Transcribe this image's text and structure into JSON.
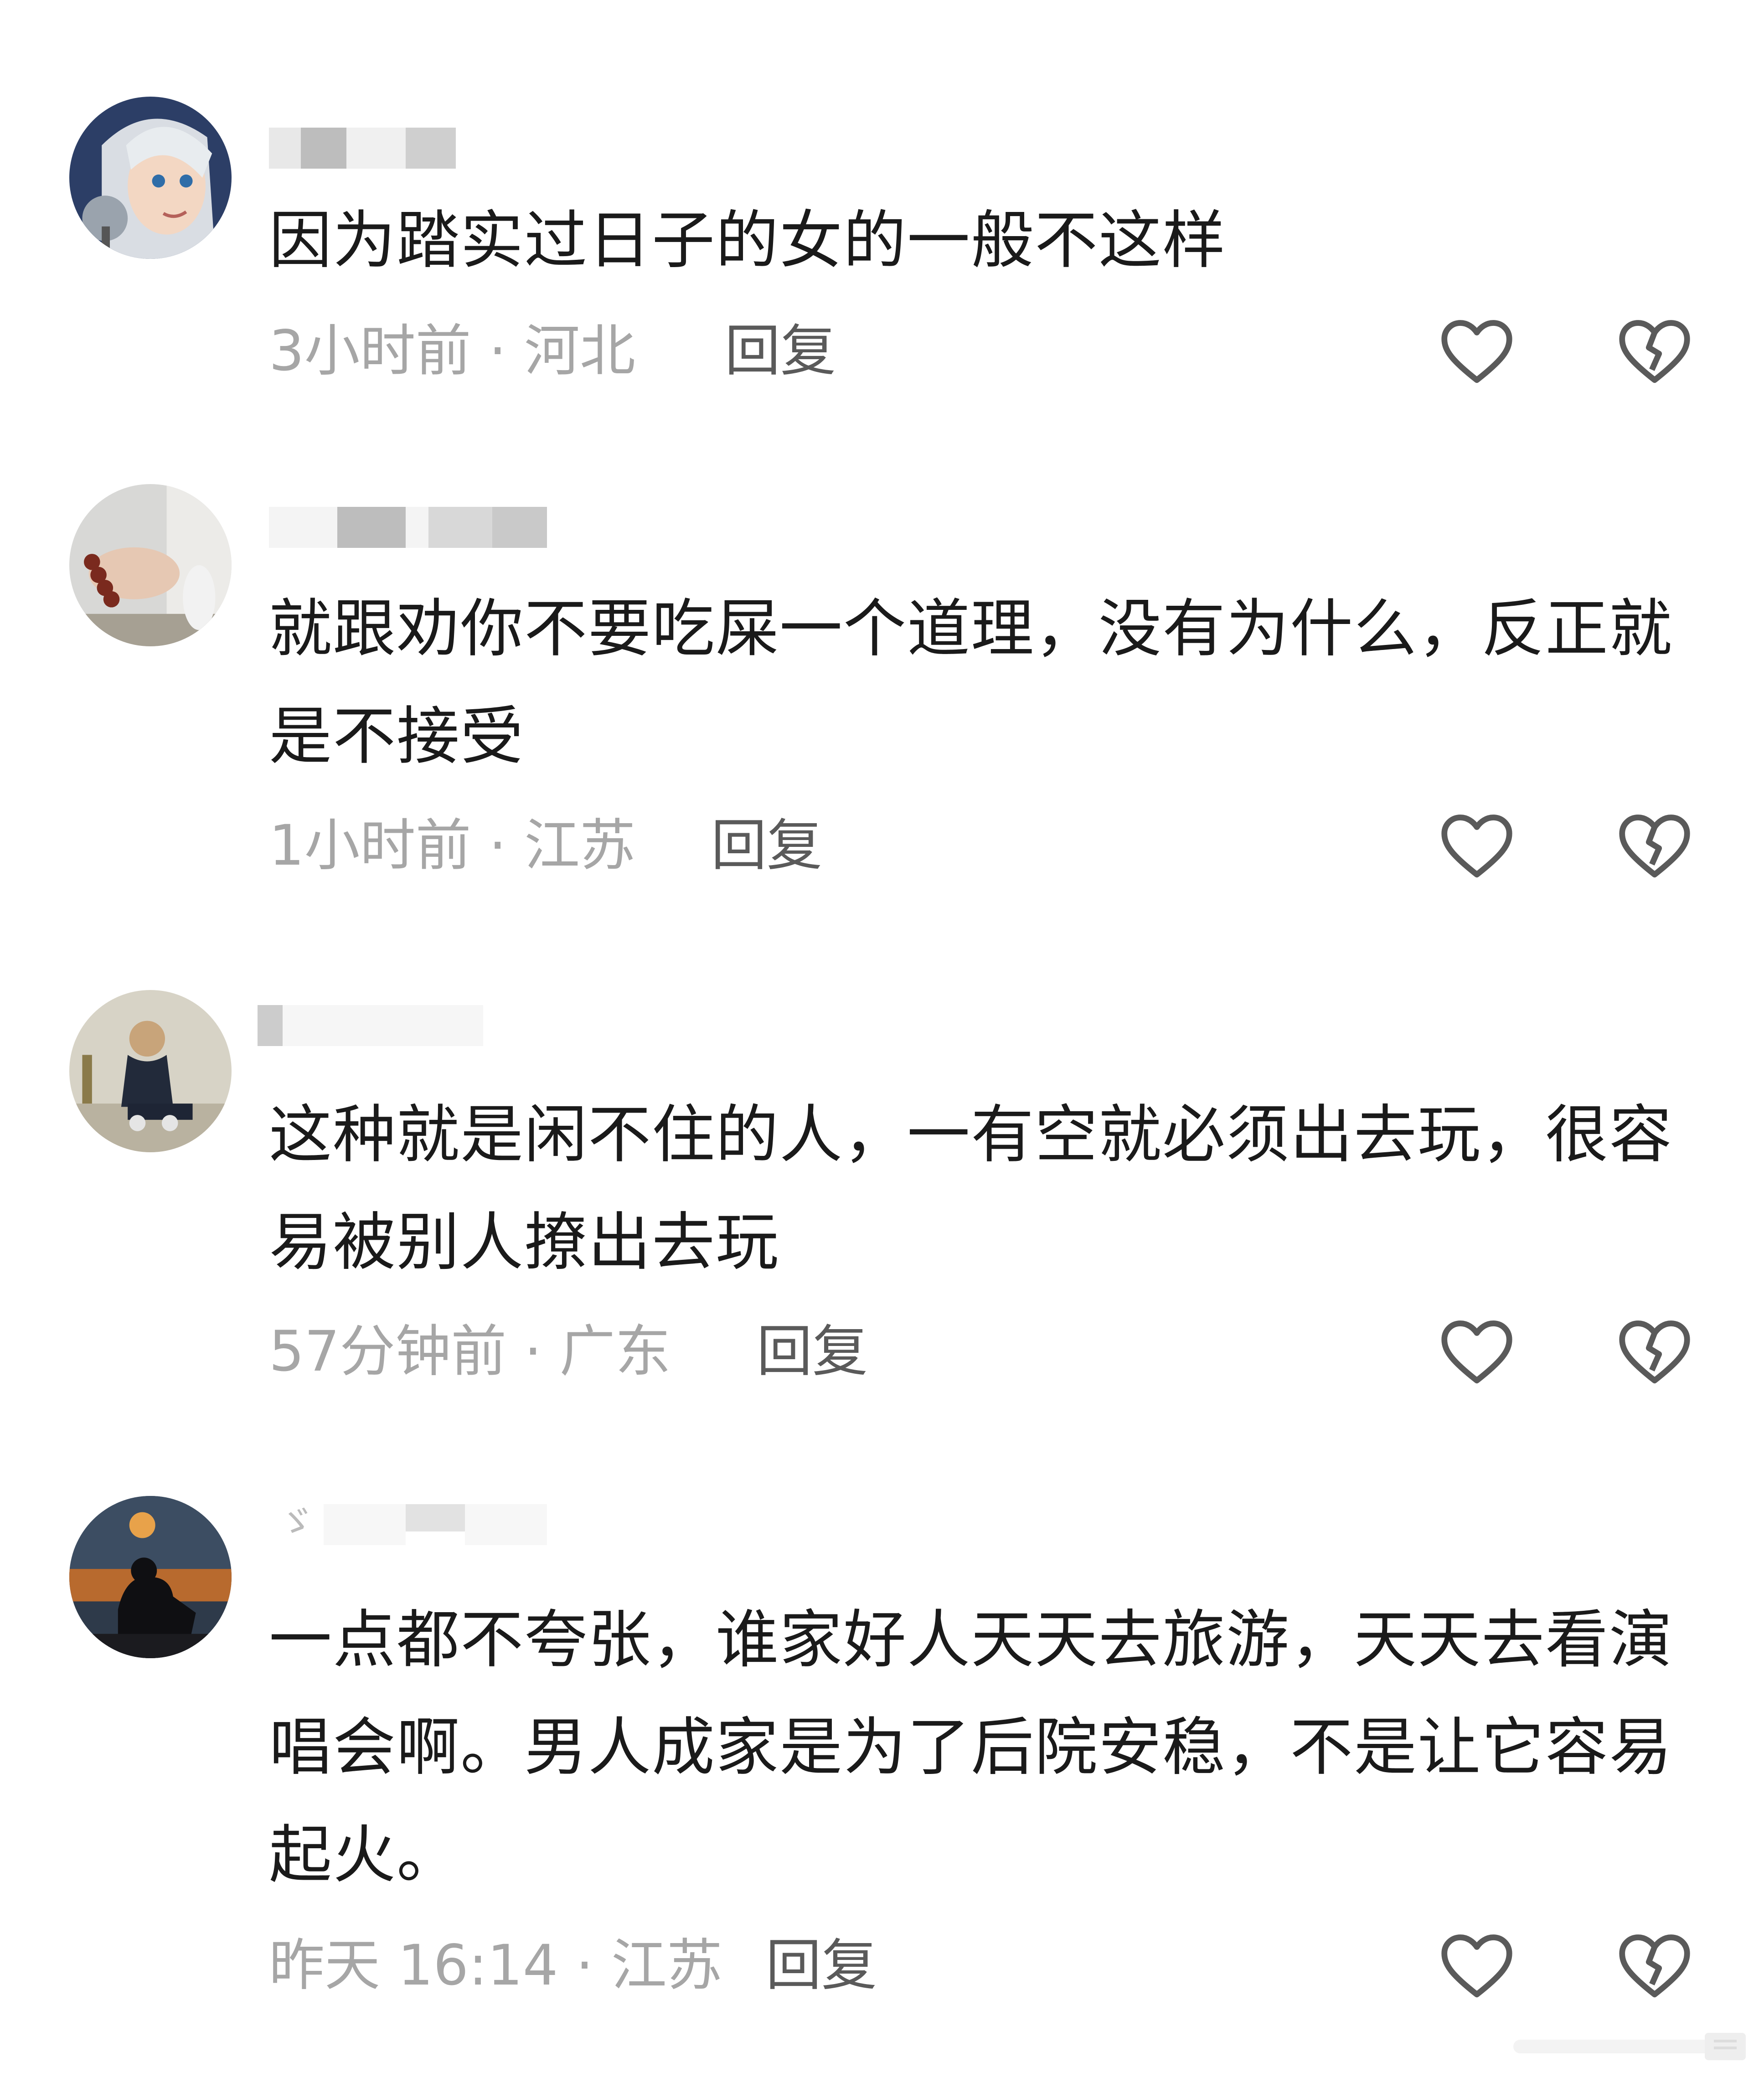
{
  "comments": [
    {
      "text": "因为踏实过日子的女的一般不这样",
      "time_location": "3小时前 · 河北",
      "reply_label": "回复"
    },
    {
      "text": "就跟劝你不要吃屎一个道理，没有为什么，反正就是不接受",
      "time_location": "1小时前 · 江苏",
      "reply_label": "回复"
    },
    {
      "text": "这种就是闲不住的人，一有空就必须出去玩，很容易被别人撩出去玩",
      "time_location": "57分钟前 · 广东",
      "reply_label": "回复"
    },
    {
      "text": "一点都不夸张，谁家好人天天去旅游，天天去看演唱会啊。男人成家是为了后院安稳，不是让它容易起火。",
      "time_location": "昨天 16:14 · 江苏",
      "reply_label": "回复"
    }
  ],
  "icons": {
    "like": "heart-outline-icon",
    "dislike": "broken-heart-icon"
  },
  "colors": {
    "text": "#1a1a1a",
    "meta": "#a6a6a6",
    "reply": "#5a5a5a",
    "icon": "#5a5a5a"
  }
}
